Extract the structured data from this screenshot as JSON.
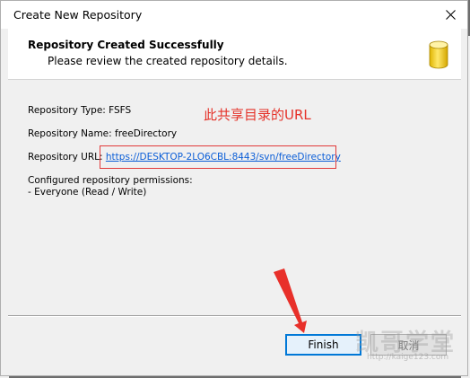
{
  "window": {
    "title": "Create New Repository",
    "close_icon": "close-icon"
  },
  "header": {
    "title": "Repository Created Successfully",
    "subtitle": "Please review the created repository details.",
    "icon": "database-icon"
  },
  "details": {
    "type_line": "Repository Type: FSFS",
    "name_line": "Repository Name: freeDirectory",
    "url_label": "Repository URL:",
    "url_value": "https://DESKTOP-2LO6CBL:8443/svn/freeDirectory",
    "permissions_heading": "Configured repository permissions:",
    "permissions_entry": "- Everyone (Read / Write)"
  },
  "annotation": {
    "text": "此共享目录的URL",
    "color": "#e53229"
  },
  "buttons": {
    "finish": "Finish",
    "cancel": "取消"
  },
  "watermark": {
    "text": "凯哥学堂",
    "url": "http://kaige123.com"
  },
  "colors": {
    "accent": "#0078d7",
    "link": "#0b5ed7",
    "annotation_red": "#e23b3b"
  }
}
